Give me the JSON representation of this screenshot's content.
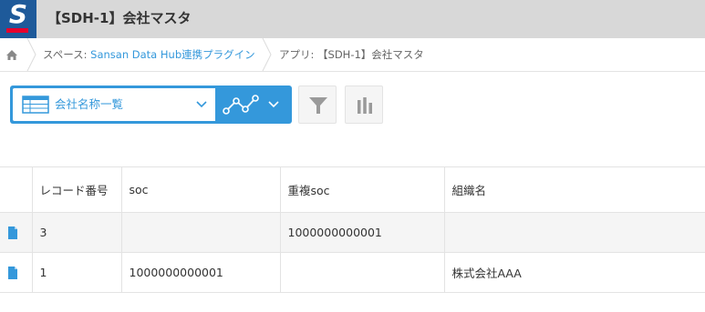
{
  "header": {
    "title": "【SDH-1】会社マスタ",
    "logo_text": "S"
  },
  "breadcrumb": {
    "space_prefix": "スペース: ",
    "space_name": "Sansan Data Hub連携プラグイン",
    "app_text": "アプリ: 【SDH-1】会社マスタ"
  },
  "toolbar": {
    "view_name": "会社名称一覧"
  },
  "table": {
    "columns": [
      "",
      "レコード番号",
      "soc",
      "重複soc",
      "組織名"
    ],
    "rows": [
      {
        "record_no": "3",
        "soc": "",
        "dup_soc": "1000000000001",
        "org": ""
      },
      {
        "record_no": "1",
        "soc": "1000000000001",
        "dup_soc": "",
        "org": "株式会社AAA"
      }
    ]
  },
  "colors": {
    "accent": "#3498db",
    "logo_bg": "#1e5a9a",
    "logo_bar": "#e6002d"
  }
}
